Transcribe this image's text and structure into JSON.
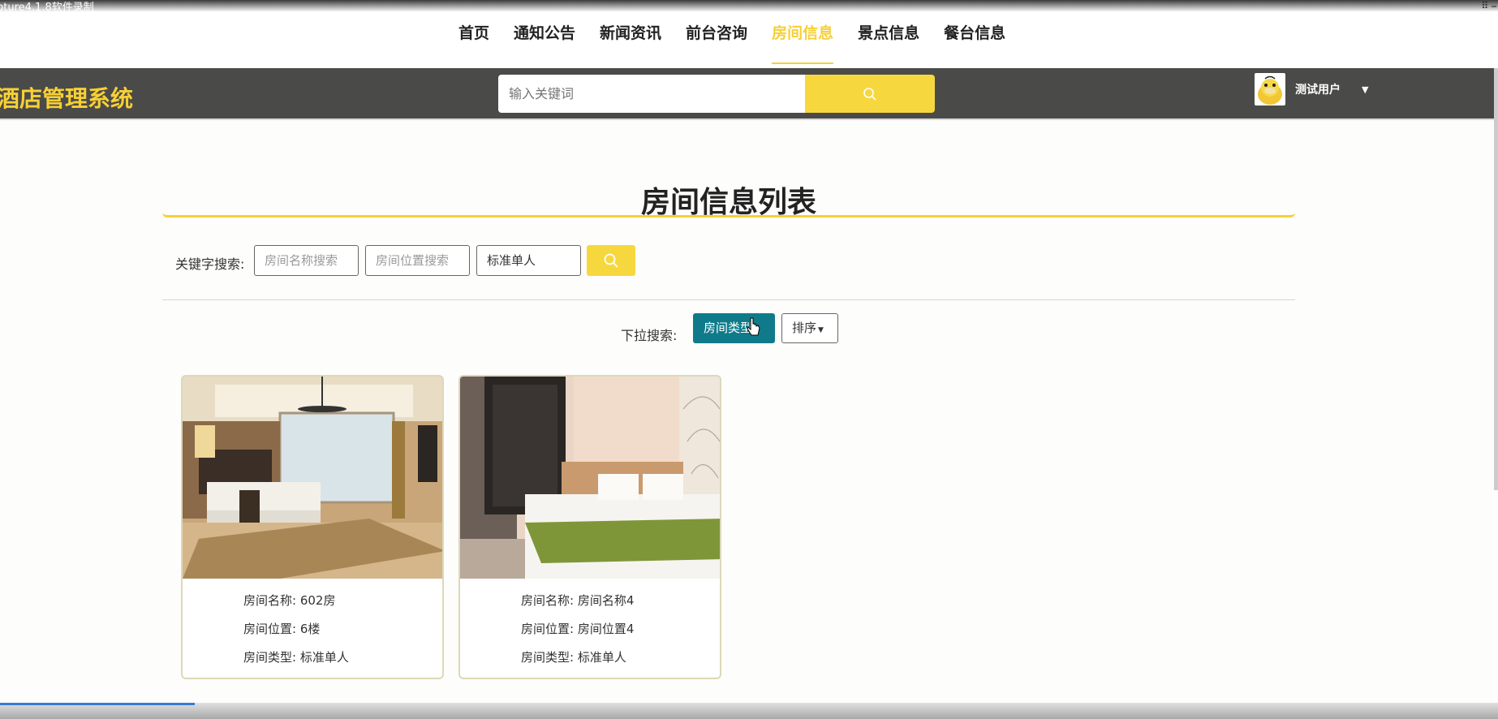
{
  "window": {
    "title": "pture4.1.8软件录制",
    "controls": "⠿ ⎯"
  },
  "nav": {
    "items": [
      {
        "label": "首页",
        "active": false
      },
      {
        "label": "通知公告",
        "active": false
      },
      {
        "label": "新闻资讯",
        "active": false
      },
      {
        "label": "前台咨询",
        "active": false
      },
      {
        "label": "房间信息",
        "active": true
      },
      {
        "label": "景点信息",
        "active": false
      },
      {
        "label": "餐台信息",
        "active": false
      }
    ]
  },
  "header": {
    "logo": "酒店管理系统",
    "search_placeholder": "输入关键词",
    "user_name": "测试用户"
  },
  "main": {
    "title": "房间信息列表",
    "keyword_label": "关键字搜索:",
    "name_placeholder": "房间名称搜索",
    "location_placeholder": "房间位置搜索",
    "type_value": "标准单人",
    "dropdown_label": "下拉搜索:",
    "type_button": "房间类型",
    "sort_button": "排序"
  },
  "rooms": [
    {
      "name_label": "房间名称: 602房",
      "location_label": "房间位置: 6楼",
      "type_label": "房间类型: 标准单人"
    },
    {
      "name_label": "房间名称: 房间名称4",
      "location_label": "房间位置: 房间位置4",
      "type_label": "房间类型: 标准单人"
    }
  ],
  "colors": {
    "accent": "#f7d035",
    "header_bg": "#4a4a48",
    "type_button": "#0f7b8a"
  }
}
